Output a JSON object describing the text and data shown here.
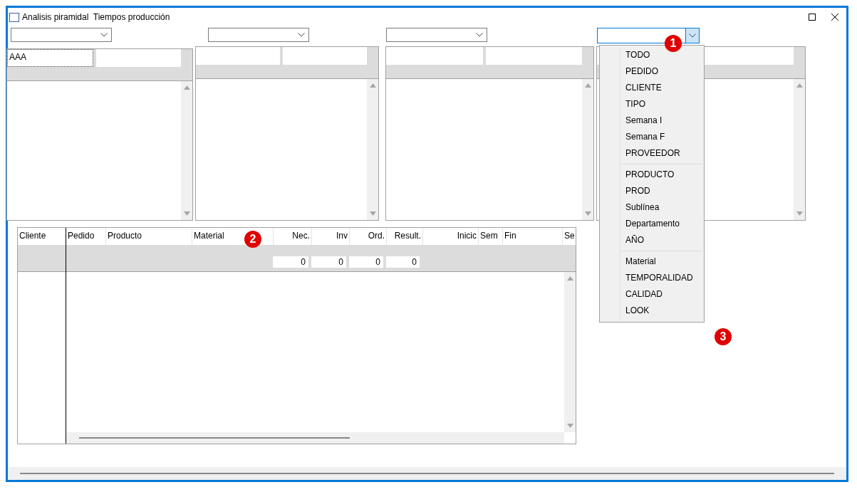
{
  "window": {
    "title": "Analisis piramidal  Tiempos producción"
  },
  "combos": [
    {
      "open": false
    },
    {
      "open": false
    },
    {
      "open": false
    },
    {
      "open": true
    }
  ],
  "panels": [
    {
      "header_value": "AAA",
      "focused": true
    },
    {
      "focused": false
    },
    {
      "focused": false
    },
    {
      "focused": false
    }
  ],
  "grid": {
    "columns": [
      "Cliente",
      "Pedido",
      "Producto",
      "Material",
      "Nec.",
      "Inv",
      "Ord.",
      "Result.",
      "Inicic",
      "Sem",
      "Fin",
      "Se"
    ],
    "totals": [
      "0",
      "0",
      "0",
      "0"
    ]
  },
  "dropdown": {
    "groups": [
      [
        "TODO",
        "PEDIDO",
        "CLIENTE",
        "TIPO",
        "Semana I",
        "Semana F",
        "PROVEEDOR"
      ],
      [
        "PRODUCTO",
        "PROD",
        "Sublínea",
        "Departamento",
        "AÑO"
      ],
      [
        "Material",
        "TEMPORALIDAD",
        "CALIDAD",
        "LOOK"
      ]
    ]
  },
  "badges": [
    "1",
    "2",
    "3"
  ]
}
